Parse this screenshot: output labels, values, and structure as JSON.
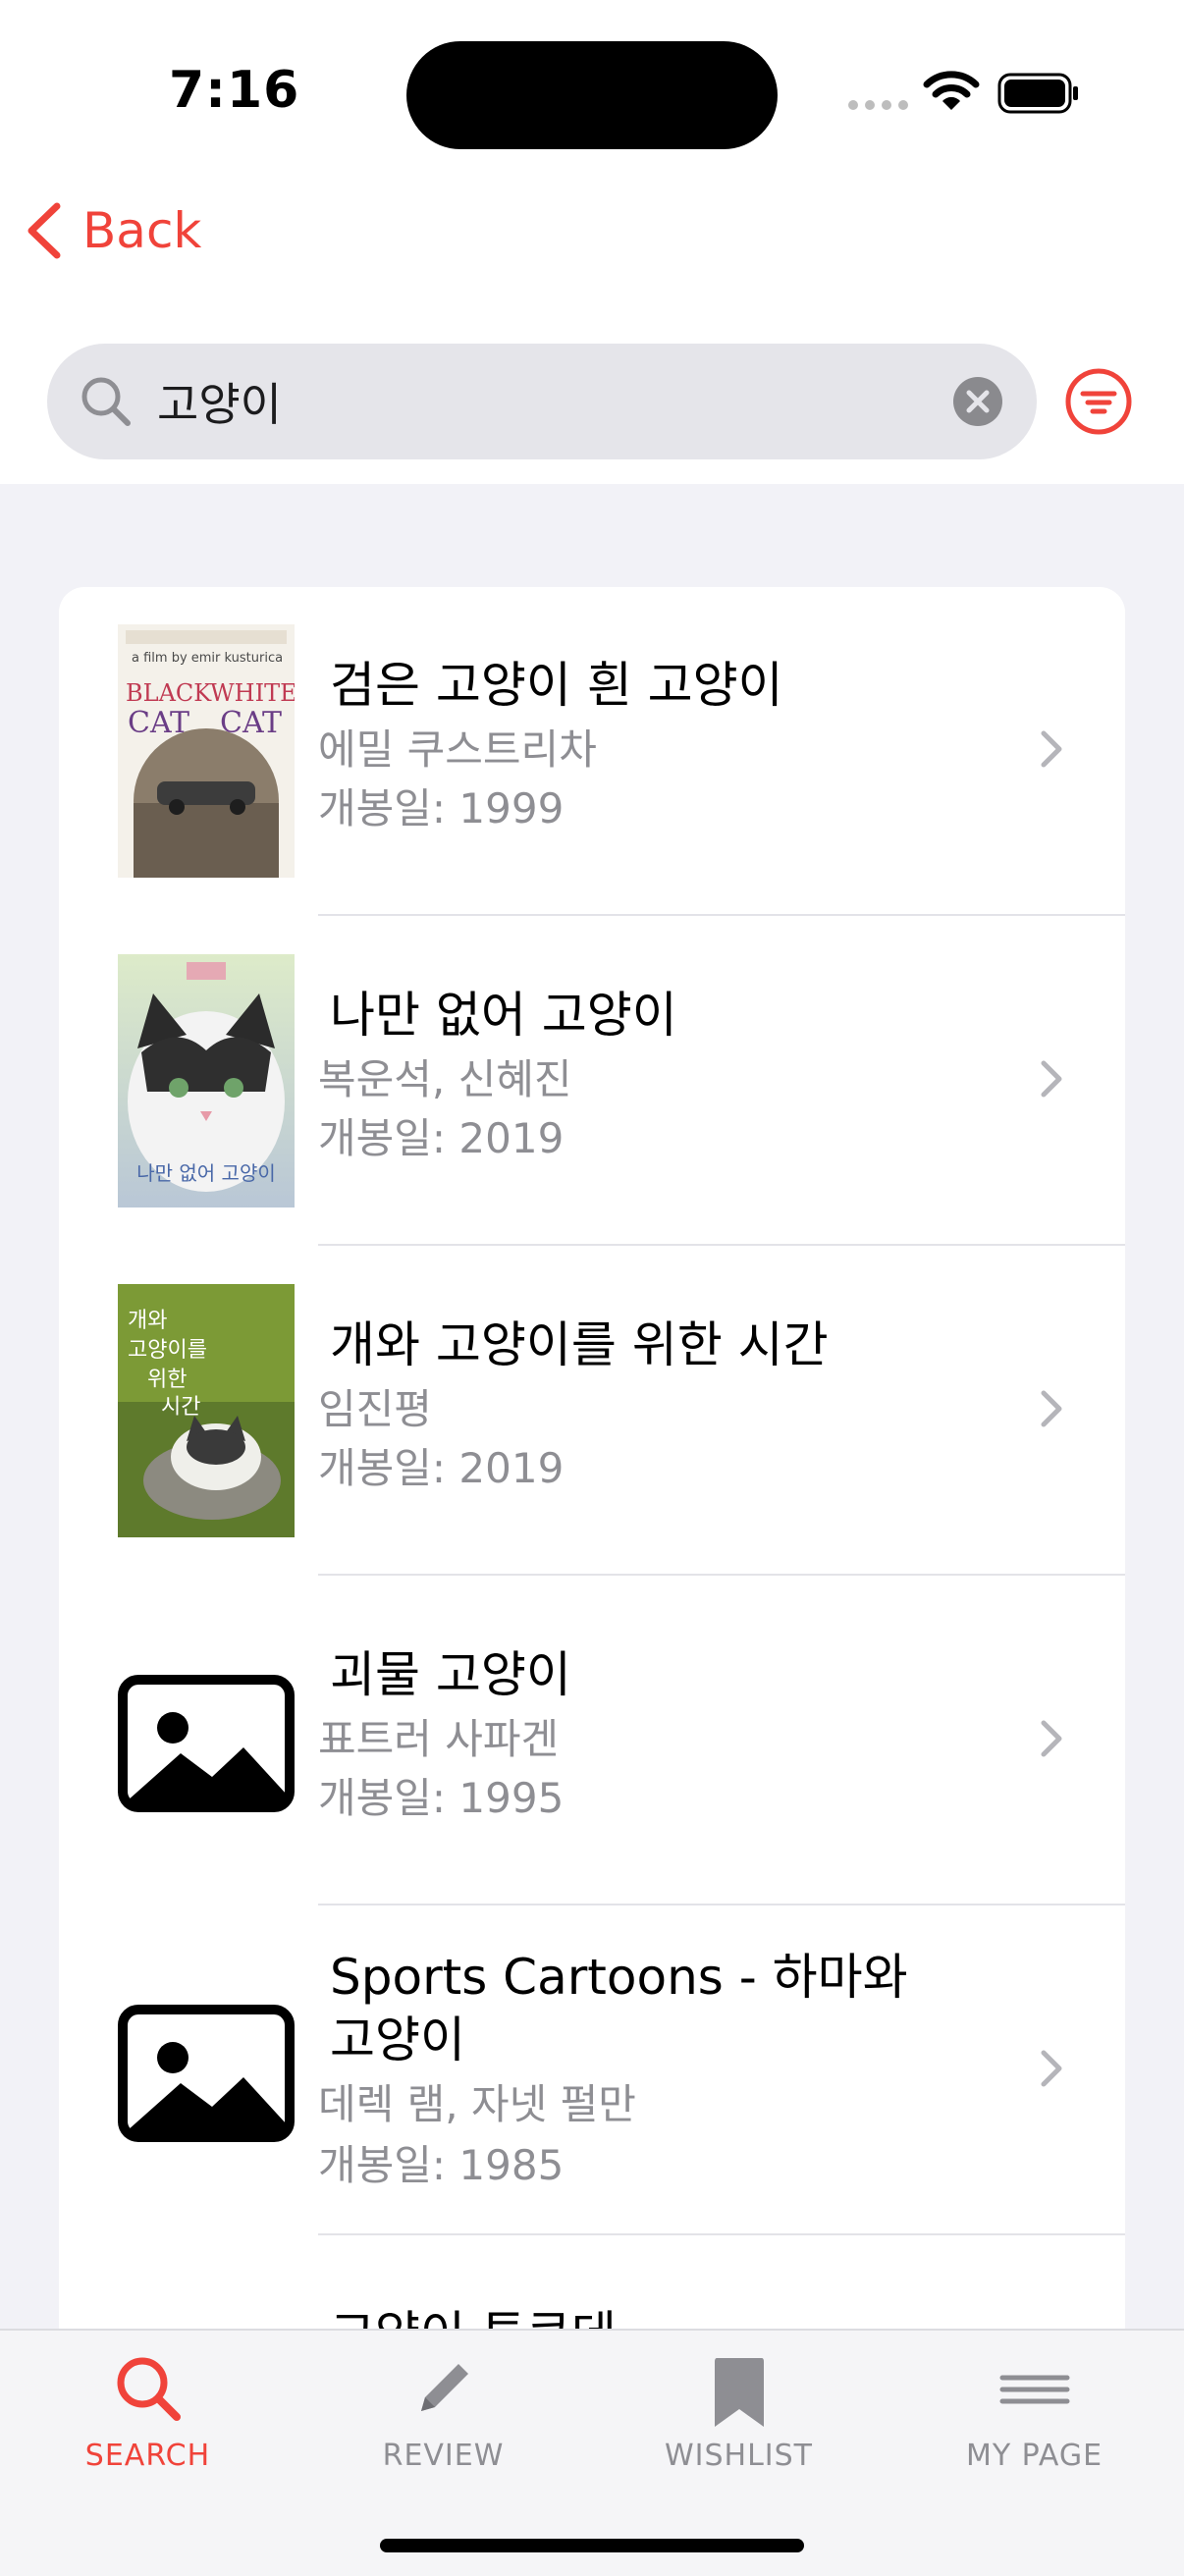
{
  "status": {
    "time": "7:16"
  },
  "nav": {
    "back_label": "Back"
  },
  "search": {
    "query": "고양이"
  },
  "results": [
    {
      "title": "검은 고양이 흰 고양이",
      "people": "에밀 쿠스트리차",
      "release": "개봉일: 1999",
      "poster": "black-cat-white-cat-poster",
      "poster_caption": "BLACK WHITE CAT CAT",
      "poster_director": "a film by emir kusturica"
    },
    {
      "title": "나만 없어 고양이",
      "people": "복운석, 신혜진",
      "release": "개봉일: 2019",
      "poster": "cat-portrait-poster",
      "poster_caption": "나만 없어 고양이"
    },
    {
      "title": "개와 고양이를 위한 시간",
      "people": "임진평",
      "release": "개봉일: 2019",
      "poster": "cat-on-rock-poster",
      "poster_caption": "개와 고양이를 위한 시간"
    },
    {
      "title": "괴물 고양이",
      "people": "표트러 사파겐",
      "release": "개봉일: 1995",
      "poster": "image-placeholder-icon"
    },
    {
      "title": "Sports Cartoons - 하마와 고양이",
      "people": "데렉 램, 자넷 펄만",
      "release": "개봉일: 1985",
      "poster": "image-placeholder-icon"
    },
    {
      "title": "고양이 투쿠데",
      "poster": "image-placeholder-icon"
    }
  ],
  "tabs": [
    {
      "label": "SEARCH",
      "icon": "search-icon",
      "active": true
    },
    {
      "label": "REVIEW",
      "icon": "pencil-icon",
      "active": false
    },
    {
      "label": "WISHLIST",
      "icon": "bookmark-icon",
      "active": false
    },
    {
      "label": "MY PAGE",
      "icon": "menu-icon",
      "active": false
    }
  ],
  "colors": {
    "accent": "#F0433A",
    "background": "#F2F2F7",
    "secondary_text": "#8E8E93"
  }
}
